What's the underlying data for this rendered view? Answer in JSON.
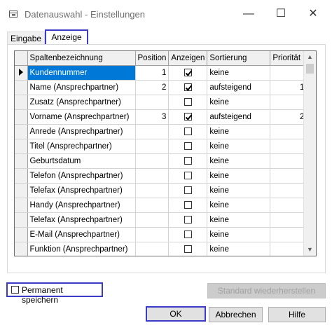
{
  "window": {
    "title": "Datenauswahl - Einstellungen",
    "minimize": "—",
    "maximize": "☐",
    "close": "✕"
  },
  "tabs": [
    {
      "label": "Eingabe"
    },
    {
      "label": "Anzeige"
    }
  ],
  "grid": {
    "columns": [
      "Spaltenbezeichnung",
      "Position",
      "Anzeigen",
      "Sortierung",
      "Priorität"
    ],
    "rows": [
      {
        "name": "Kundennummer",
        "position": "1",
        "show": true,
        "sort": "keine",
        "priority": "",
        "selected": true
      },
      {
        "name": "Name (Ansprechpartner)",
        "position": "2",
        "show": true,
        "sort": "aufsteigend",
        "priority": "1"
      },
      {
        "name": "Zusatz (Ansprechpartner)",
        "position": "",
        "show": false,
        "sort": "keine",
        "priority": ""
      },
      {
        "name": "Vorname (Ansprechpartner)",
        "position": "3",
        "show": true,
        "sort": "aufsteigend",
        "priority": "2"
      },
      {
        "name": "Anrede (Ansprechpartner)",
        "position": "",
        "show": false,
        "sort": "keine",
        "priority": ""
      },
      {
        "name": "Titel (Ansprechpartner)",
        "position": "",
        "show": false,
        "sort": "keine",
        "priority": ""
      },
      {
        "name": "Geburtsdatum",
        "position": "",
        "show": false,
        "sort": "keine",
        "priority": ""
      },
      {
        "name": "Telefon (Ansprechpartner)",
        "position": "",
        "show": false,
        "sort": "keine",
        "priority": ""
      },
      {
        "name": "Telefax (Ansprechpartner)",
        "position": "",
        "show": false,
        "sort": "keine",
        "priority": ""
      },
      {
        "name": "Handy (Ansprechpartner)",
        "position": "",
        "show": false,
        "sort": "keine",
        "priority": ""
      },
      {
        "name": "Telefax (Ansprechpartner)",
        "position": "",
        "show": false,
        "sort": "keine",
        "priority": ""
      },
      {
        "name": "E-Mail (Ansprechpartner)",
        "position": "",
        "show": false,
        "sort": "keine",
        "priority": ""
      },
      {
        "name": "Funktion (Ansprechpartner)",
        "position": "",
        "show": false,
        "sort": "keine",
        "priority": ""
      }
    ]
  },
  "permanent": {
    "label": "Permanent speichern",
    "checked": false
  },
  "buttons": {
    "restore": "Standard wiederherstellen",
    "ok": "OK",
    "cancel": "Abbrechen",
    "help": "Hilfe"
  },
  "colors": {
    "selection": "#0078d7",
    "highlight_border": "#3b3bc8"
  }
}
